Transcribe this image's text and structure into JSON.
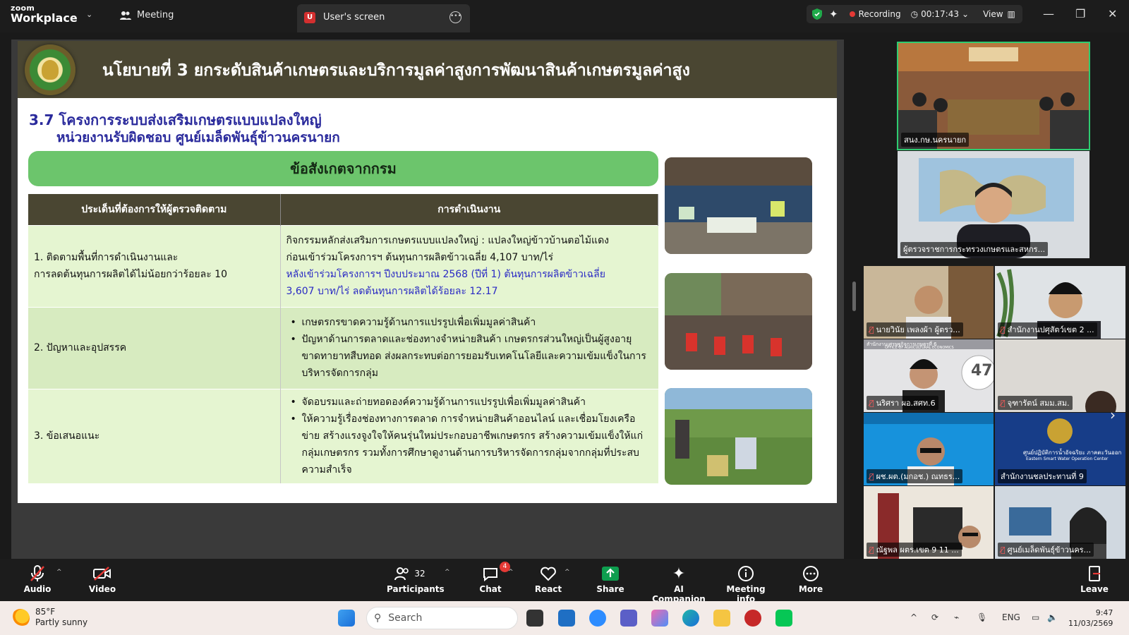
{
  "app": {
    "brand_top": "zoom",
    "brand_bottom": "Workplace",
    "meeting_tab": "Meeting",
    "screen_tab_badge": "U",
    "screen_tab": "User's screen",
    "recording_label": "Recording",
    "elapsed": "00:17:43",
    "view_label": "View"
  },
  "slide": {
    "title": "นโยบายที่ 3 ยกระดับสินค้าเกษตรและบริการมูลค่าสูงการพัฒนาสินค้าเกษตรมูลค่าสูง",
    "subtitle1": "3.7 โครงการระบบส่งเสริมเกษตรแบบแปลงใหญ่",
    "subtitle2": "หน่วยงานรับผิดชอบ  ศูนย์เมล็ดพันธุ์ข้าวนครนายก",
    "banner": "ข้อสังเกตจากกรม",
    "col1_header": "ประเด็นที่ต้องการให้ผู้ตรวจติดตาม",
    "col2_header": "การดำเนินงาน",
    "row1_issue_line1": "1. ติดตามพื้นที่การดำเนินงานและ",
    "row1_issue_line2": "การลดต้นทุนการผลิตได้ไม่น้อยกว่าร้อยละ 10",
    "row1_action_line1": "กิจกรรมหลักส่งเสริมการเกษตรแบบแปลงใหญ่ : แปลงใหญ่ข้าวบ้านตอไม้แดง",
    "row1_action_line2": "ก่อนเข้าร่วมโครงการฯ ต้นทุนการผลิตข้าวเฉลี่ย 4,107 บาท/ไร่",
    "row1_action_line3": "หลังเข้าร่วมโครงการฯ ปีงบประมาณ 2568 (ปีที่ 1) ต้นทุนการผลิตข้าวเฉลี่ย",
    "row1_action_line4": "3,607 บาท/ไร่ ลดต้นทุนการผลิตได้ร้อยละ 12.17",
    "row2_issue": "2. ปัญหาและอุปสรรค",
    "row2_bullet1": "เกษตรกรขาดความรู้ด้านการแปรรูปเพื่อเพิ่มมูลค่าสินค้า",
    "row2_bullet2": "ปัญหาด้านการตลาดและช่องทางจำหน่ายสินค้า เกษตรกรส่วนใหญ่เป็นผู้สูงอายุ ขาดทายาทสืบทอด ส่งผลกระทบต่อการยอมรับเทคโนโลยีและความเข้มแข็งในการบริหารจัดการกลุ่ม",
    "row3_issue": "3. ข้อเสนอแนะ",
    "row3_bullet1": "จัดอบรมและถ่ายทอดองค์ความรู้ด้านการแปรรูปเพื่อเพิ่มมูลค่าสินค้า",
    "row3_bullet2": "ให้ความรู้เรื่องช่องทางการตลาด การจำหน่ายสินค้าออนไลน์ และเชื่อมโยงเครือข่าย สร้างแรงจูงใจให้คนรุ่นใหม่ประกอบอาชีพเกษตรกร สร้างความเข้มแข็งให้แก่กลุ่มเกษตรกร รวมทั้งการศึกษาดูงานด้านการบริหารจัดการกลุ่มจากกลุ่มที่ประสบความสำเร็จ"
  },
  "participants": [
    {
      "name": "สนง.กษ.นครนายก",
      "muted": false
    },
    {
      "name": "ผู้ตรวจราชการกระทรวงเกษตรและสหกร...",
      "muted": false
    },
    {
      "name": "นายวินัย เพลงผ้า ผู้ตรว...",
      "muted": true
    },
    {
      "name": "สำนักงานปศุสัตว์เขต 2 ...",
      "muted": true
    },
    {
      "name": "นริศรา ผอ.สศท.6",
      "muted": true
    },
    {
      "name": "จุฑารัตน์ สมม.สม.",
      "muted": true
    },
    {
      "name": "ผช.ผต.(มกอช.) ณทธร...",
      "muted": true
    },
    {
      "name": "สำนักงานชลประทานที่ 9",
      "muted": false
    },
    {
      "name": "ณัฐพล ผตร.เขต 9 11 ...",
      "muted": true
    },
    {
      "name": "ศูนย์เมล็ดพันธุ์ข้าวนคร...",
      "muted": true
    }
  ],
  "tile_overlay": {
    "badge_number": "47",
    "office_label": "สำนักงานเศรษฐกิจการเกษตรที่ 6",
    "office_label_en": "OFFICE OF AGRICULTURAL ECONOMICS",
    "center_label": "ศูนย์ปฏิบัติการน้ำอัจฉริยะ ภาคตะวันออก",
    "center_label_en": "Eastern Smart Water Operation Center"
  },
  "toolbar": {
    "audio": "Audio",
    "video": "Video",
    "participants": "Participants",
    "participants_count": "32",
    "chat": "Chat",
    "chat_badge": "4",
    "react": "React",
    "share": "Share",
    "ai": "AI Companion",
    "info": "Meeting info",
    "more": "More",
    "leave": "Leave"
  },
  "taskbar": {
    "temperature": "85°F",
    "weather": "Partly sunny",
    "search_placeholder": "Search",
    "language": "ENG",
    "time": "9:47",
    "date": "11/03/2569"
  },
  "colors": {
    "slide_header": "#4a4632",
    "banner_green": "#6cc56c",
    "subtitle_blue": "#2a2a9c",
    "active_speaker_border": "#2ecc71",
    "share_green": "#0e9e4f",
    "recording_red": "#e53935"
  }
}
